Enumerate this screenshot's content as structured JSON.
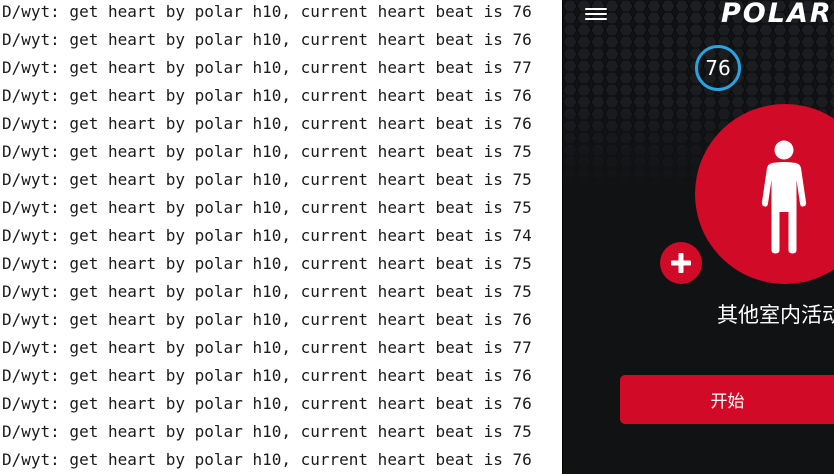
{
  "log": {
    "lines": [
      "D/wyt: get heart by polar h10, current heart beat is 76",
      "D/wyt: get heart by polar h10, current heart beat is 76",
      "D/wyt: get heart by polar h10, current heart beat is 77",
      "D/wyt: get heart by polar h10, current heart beat is 76",
      "D/wyt: get heart by polar h10, current heart beat is 76",
      "D/wyt: get heart by polar h10, current heart beat is 75",
      "D/wyt: get heart by polar h10, current heart beat is 75",
      "D/wyt: get heart by polar h10, current heart beat is 75",
      "D/wyt: get heart by polar h10, current heart beat is 74",
      "D/wyt: get heart by polar h10, current heart beat is 75",
      "D/wyt: get heart by polar h10, current heart beat is 75",
      "D/wyt: get heart by polar h10, current heart beat is 76",
      "D/wyt: get heart by polar h10, current heart beat is 77",
      "D/wyt: get heart by polar h10, current heart beat is 76",
      "D/wyt: get heart by polar h10, current heart beat is 76",
      "D/wyt: get heart by polar h10, current heart beat is 75",
      "D/wyt: get heart by polar h10, current heart beat is 76"
    ]
  },
  "app": {
    "brand": "POLAR",
    "menu_icon": "hamburger-menu-icon",
    "heart_rate": "76",
    "sport_icon": "person-standing-icon",
    "add_icon": "plus-icon",
    "sport_name": "其他室内活动",
    "start_label": "开始",
    "colors": {
      "background": "#111214",
      "accent_red": "#d10a27",
      "hr_ring_blue": "#2aa3e0",
      "text": "#ffffff"
    }
  }
}
